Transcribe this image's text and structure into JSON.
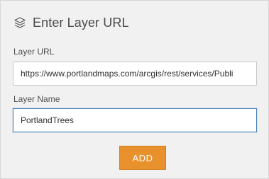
{
  "header": {
    "icon": "layers-icon",
    "title": "Enter Layer URL"
  },
  "form": {
    "url_label": "Layer URL",
    "url_value": "https://www.portlandmaps.com/arcgis/rest/services/Publi",
    "name_label": "Layer Name",
    "name_value": "PortlandTrees"
  },
  "actions": {
    "add_label": "ADD"
  },
  "colors": {
    "panel_bg": "#f1f1f1",
    "accent": "#e8912d",
    "focus_border": "#4a7fb8"
  }
}
